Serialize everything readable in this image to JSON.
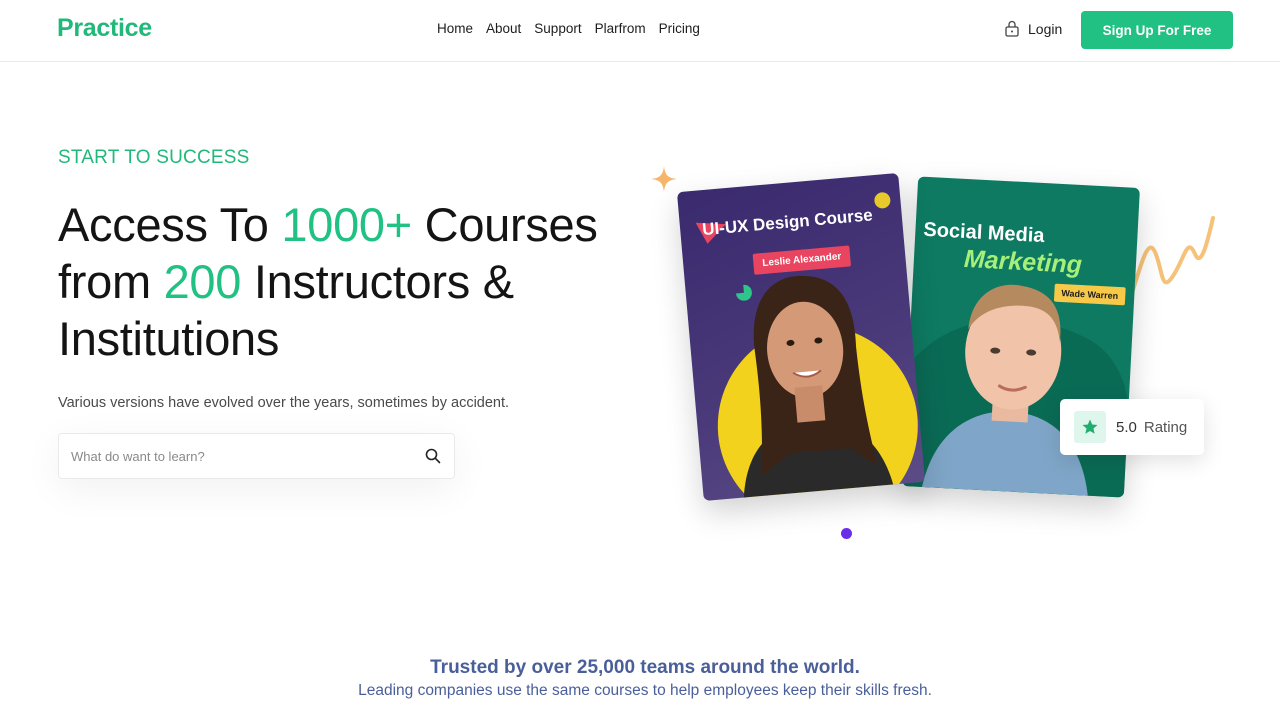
{
  "header": {
    "logo": "Practice",
    "nav": [
      "Home",
      "About",
      "Support",
      "Plarfrom",
      "Pricing"
    ],
    "login_label": "Login",
    "signup_label": "Sign Up For Free"
  },
  "hero": {
    "eyebrow": "START TO SUCCESS",
    "headline": {
      "part1": "Access To ",
      "highlight1": "1000+",
      "part2": " Courses from ",
      "highlight2": "200",
      "part3": " Instructors & Institutions"
    },
    "subtext": "Various versions have evolved over the years, sometimes by accident.",
    "search": {
      "placeholder": "What do want to learn?"
    }
  },
  "cards": [
    {
      "title": "UI-UX Design Course",
      "instructor": "Leslie Alexander"
    },
    {
      "title_line1": "Social Media",
      "title_line2": "Marketing",
      "instructor": "Wade Warren"
    }
  ],
  "rating": {
    "value": "5.0",
    "label": "Rating"
  },
  "trusted": {
    "title": "Trusted by over 25,000 teams around the world.",
    "subtitle": "Leading companies use the same courses to help employees keep their skills fresh."
  },
  "colors": {
    "brand": "#20c182",
    "accent_purple": "#6a2ee8",
    "trusted_text": "#4a5f9a"
  }
}
